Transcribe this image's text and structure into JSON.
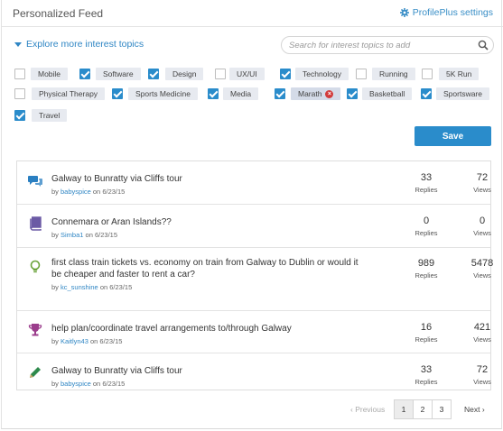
{
  "header": {
    "title": "Personalized Feed",
    "settings_label": "ProfilePlus settings"
  },
  "explore": {
    "label": "Explore more interest topics"
  },
  "search": {
    "placeholder": "Search for interest topics to add"
  },
  "topics": [
    {
      "label": "Mobile",
      "checked": false
    },
    {
      "label": "Software",
      "checked": true
    },
    {
      "label": "Design",
      "checked": true
    },
    {
      "label": "UX/UI",
      "checked": false
    },
    {
      "label": "Technology",
      "checked": true
    },
    {
      "label": "Running",
      "checked": false
    },
    {
      "label": "5K Run",
      "checked": false
    },
    {
      "label": "Physical Therapy",
      "checked": false
    },
    {
      "label": "Sports Medicine",
      "checked": true
    },
    {
      "label": "Media",
      "checked": true
    },
    {
      "label": "Marath",
      "checked": true,
      "removable": true
    },
    {
      "label": "Basketball",
      "checked": true
    },
    {
      "label": "Sportsware",
      "checked": true
    },
    {
      "label": "Travel",
      "checked": true
    }
  ],
  "save_label": "Save",
  "feed": [
    {
      "icon": "speech-bubbles-icon",
      "icon_color": "#2a7fc1",
      "title_lines": [
        "Galway to Bunratty via Cliffs tour"
      ],
      "by": "by",
      "user": "babyspice",
      "date": "on 6/23/15",
      "replies": "33",
      "views": "72"
    },
    {
      "icon": "book-icon",
      "icon_color": "#6b5aa5",
      "title_lines": [
        "Connemara or Aran Islands??"
      ],
      "by": "by",
      "user": "Simba1",
      "date": "on 6/23/15",
      "replies": "0",
      "views": "0"
    },
    {
      "icon": "lightbulb-icon",
      "icon_color": "#6aa33a",
      "title_lines": [
        "first class train tickets vs. economy on train from Galway to Dublin or would it",
        "be cheaper and faster to rent a car?"
      ],
      "by": "by",
      "user": "kc_sunshine",
      "date": "on 6/23/15",
      "replies": "989",
      "views": "5478"
    },
    {
      "icon": "trophy-icon",
      "icon_color": "#9b3d8c",
      "title_lines": [
        "help plan/coordinate travel arrangements to/through Galway"
      ],
      "by": "by",
      "user": "Kaitlyn43",
      "date": "on 6/23/15",
      "replies": "16",
      "views": "421"
    },
    {
      "icon": "pencil-icon",
      "icon_color": "#2e8a4c",
      "title_lines": [
        "Galway to Bunratty via Cliffs tour"
      ],
      "by": "by",
      "user": "babyspice",
      "date": "on 6/23/15",
      "replies": "33",
      "views": "72"
    }
  ],
  "stat_labels": {
    "replies": "Replies",
    "views": "Views"
  },
  "pagination": {
    "previous": "‹ Previous",
    "pages": [
      "1",
      "2",
      "3"
    ],
    "active": "1",
    "next": "Next ›"
  }
}
